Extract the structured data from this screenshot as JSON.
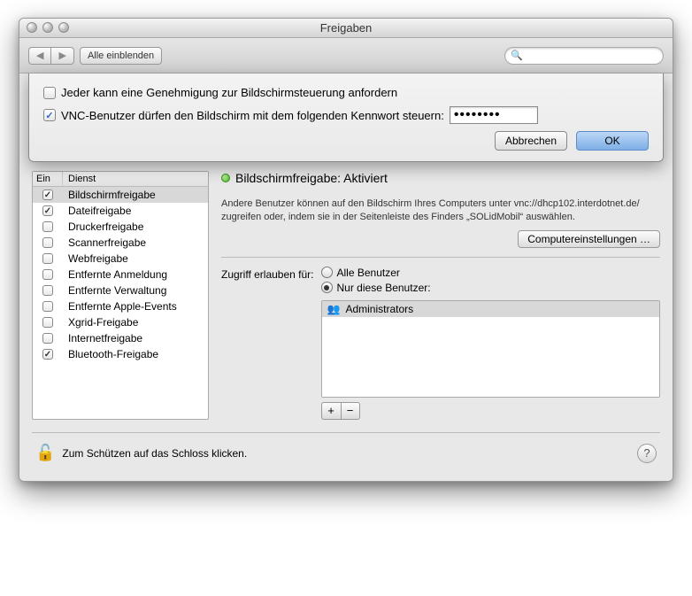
{
  "window": {
    "title": "Freigaben"
  },
  "toolbar": {
    "show_all": "Alle einblenden",
    "search_placeholder": ""
  },
  "sheet": {
    "opt1_label": "Jeder kann eine Genehmigung zur Bildschirmsteuerung anfordern",
    "opt2_label": "VNC-Benutzer dürfen den Bildschirm mit dem folgenden Kennwort steuern:",
    "password_mask": "••••••••",
    "cancel": "Abbrechen",
    "ok": "OK"
  },
  "services": {
    "head_on": "Ein",
    "head_name": "Dienst",
    "items": [
      {
        "on": true,
        "label": "Bildschirmfreigabe",
        "selected": true
      },
      {
        "on": true,
        "label": "Dateifreigabe"
      },
      {
        "on": false,
        "label": "Druckerfreigabe"
      },
      {
        "on": false,
        "label": "Scannerfreigabe"
      },
      {
        "on": false,
        "label": "Webfreigabe"
      },
      {
        "on": false,
        "label": "Entfernte Anmeldung"
      },
      {
        "on": false,
        "label": "Entfernte Verwaltung"
      },
      {
        "on": false,
        "label": "Entfernte Apple-Events"
      },
      {
        "on": false,
        "label": "Xgrid-Freigabe"
      },
      {
        "on": false,
        "label": "Internetfreigabe"
      },
      {
        "on": true,
        "label": "Bluetooth-Freigabe"
      }
    ]
  },
  "detail": {
    "status": "Bildschirmfreigabe: Aktiviert",
    "desc": "Andere Benutzer können auf den Bildschirm Ihres Computers unter vnc://dhcp102.interdotnet.de/ zugreifen oder, indem sie in der Seitenleiste des Finders „SOLidMobil“ auswählen.",
    "computer_settings": "Computereinstellungen …",
    "access_label": "Zugriff erlauben für:",
    "radio_all": "Alle Benutzer",
    "radio_only": "Nur diese Benutzer:",
    "user0": "Administrators"
  },
  "footer": {
    "lock_text": "Zum Schützen auf das Schloss klicken."
  }
}
